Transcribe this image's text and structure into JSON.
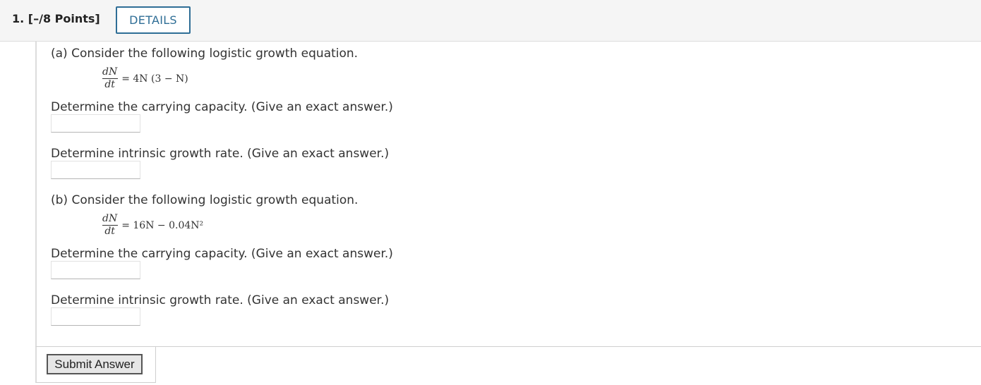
{
  "question": {
    "label": "1. [–/8 Points]",
    "details_label": "DETAILS"
  },
  "part_a": {
    "intro": "(a) Consider the following logistic growth equation.",
    "eq_num": "dN",
    "eq_den": "dt",
    "eq_rhs": "= 4N (3 − N)",
    "prompt_capacity": "Determine the carrying capacity. (Give an exact answer.)",
    "prompt_rate": "Determine intrinsic growth rate. (Give an exact answer.)",
    "capacity_value": "",
    "rate_value": ""
  },
  "part_b": {
    "intro": "(b) Consider the following logistic growth equation.",
    "eq_num": "dN",
    "eq_den": "dt",
    "eq_rhs": "= 16N − 0.04N²",
    "prompt_capacity": "Determine the carrying capacity. (Give an exact answer.)",
    "prompt_rate": "Determine intrinsic growth rate. (Give an exact answer.)",
    "capacity_value": "",
    "rate_value": ""
  },
  "submit_label": "Submit Answer"
}
